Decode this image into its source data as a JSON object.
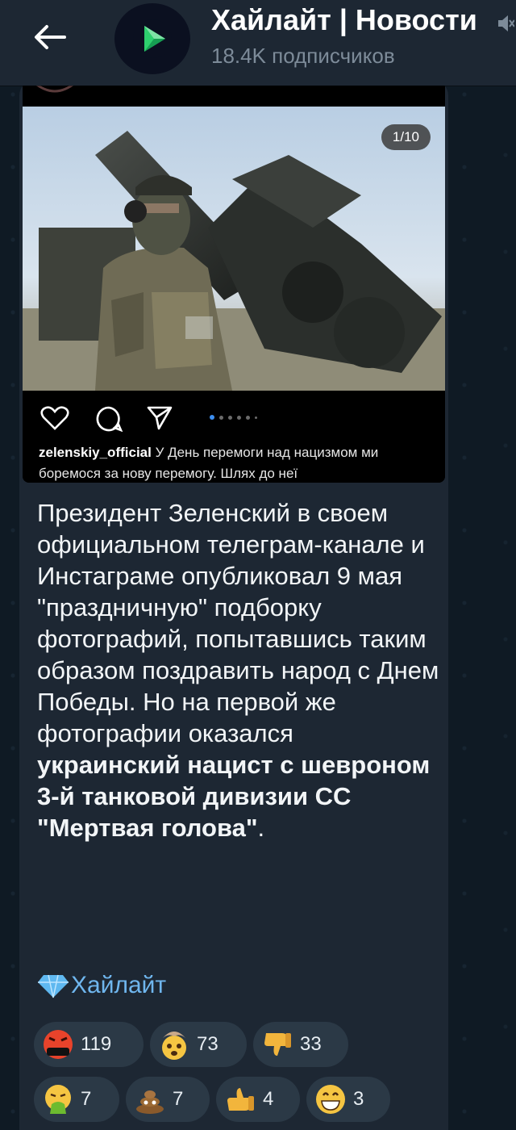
{
  "header": {
    "title": "Хайлайт | Новости",
    "subscribers": "18.4K подписчиков"
  },
  "post": {
    "image_counter": "1/10",
    "insta_username": "zelenskiy_official",
    "insta_caption": " У День перемоги над нацизмом ми боремося за нову перемогу. Шлях до неї",
    "text_part1": "Президент Зеленский в своем официальном телеграм-канале и Инстаграме опубликовал 9 мая \"праздничную\" подборку фотографий, попытавшись таким образом поздравить народ с Днем Победы. Но на первой же фотографии оказался ",
    "text_bold": "украинский нацист с шевроном 3-й танковой дивизии СС \"Мертвая голова\"",
    "text_end": ".",
    "signature": "Хайлайт"
  },
  "reactions": [
    {
      "emoji": "angry-face-icon",
      "count": "119"
    },
    {
      "emoji": "exploding-head-icon",
      "count": "73"
    },
    {
      "emoji": "thumbs-down-icon",
      "count": "33"
    },
    {
      "emoji": "vomiting-face-icon",
      "count": "7"
    },
    {
      "emoji": "poop-icon",
      "count": "7"
    },
    {
      "emoji": "thumbs-up-icon",
      "count": "4"
    },
    {
      "emoji": "grinning-face-icon",
      "count": "3"
    }
  ],
  "colors": {
    "background": "#0f1a24",
    "header": "#1d2733",
    "bubble": "#1d2733",
    "reaction": "#2b3946",
    "link": "#6fb6ee",
    "muted": "#7d8b99"
  }
}
